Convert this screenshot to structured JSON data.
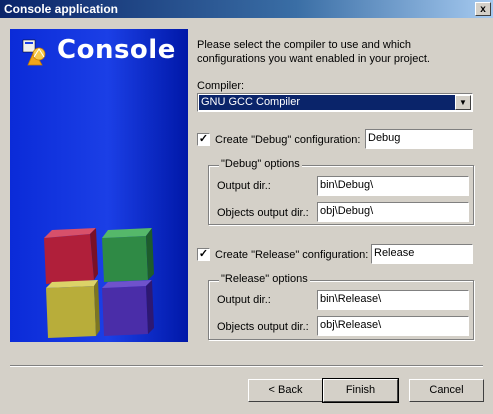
{
  "window": {
    "title": "Console application",
    "close_glyph": "x"
  },
  "banner": {
    "title": "Console",
    "logo_icon": "codeblocks-logo-icon"
  },
  "intro_text": "Please select the compiler to use and which configurations you want enabled in your project.",
  "compiler": {
    "label": "Compiler:",
    "selected": "GNU GCC Compiler"
  },
  "debug": {
    "checkbox_label": "Create \"Debug\" configuration:",
    "checked": true,
    "name": "Debug",
    "group_title": "\"Debug\" options",
    "output_label": "Output dir.:",
    "output_value": "bin\\Debug\\",
    "objects_label": "Objects output dir.:",
    "objects_value": "obj\\Debug\\"
  },
  "release": {
    "checkbox_label": "Create \"Release\" configuration:",
    "checked": true,
    "name": "Release",
    "group_title": "\"Release\" options",
    "output_label": "Output dir.:",
    "output_value": "bin\\Release\\",
    "objects_label": "Objects output dir.:",
    "objects_value": "obj\\Release\\"
  },
  "buttons": {
    "back": "< Back",
    "finish": "Finish",
    "cancel": "Cancel"
  },
  "colors": {
    "titlebar": "#0a246a",
    "banner": "#1b3fe6",
    "face": "#d4d0c8",
    "selection": "#0a246a"
  }
}
